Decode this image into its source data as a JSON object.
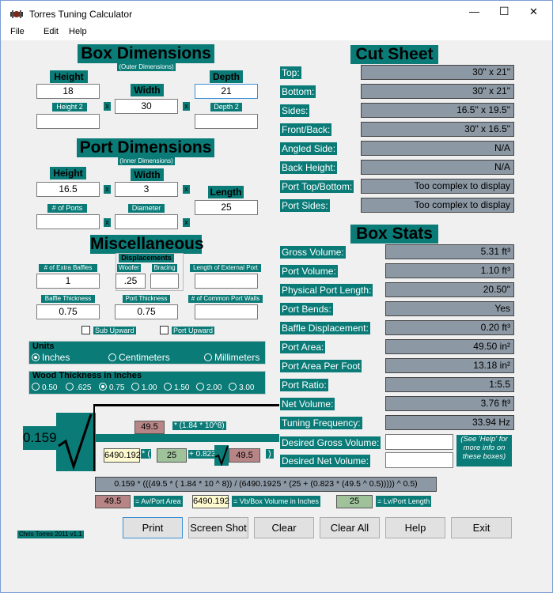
{
  "window": {
    "title": "Torres Tuning Calculator",
    "minimize": "—",
    "maximize": "☐",
    "close": "✕"
  },
  "menu": [
    "File",
    "Edit",
    "Help"
  ],
  "box_dimensions": {
    "title": "Box Dimensions",
    "subtitle": "(Outer Dimensions)",
    "height_label": "Height",
    "height_value": "18",
    "width_label": "Width",
    "width_value": "30",
    "depth_label": "Depth",
    "depth_value": "21",
    "height2_label": "Height 2",
    "height2_value": "",
    "depth2_label": "Depth 2",
    "depth2_value": "",
    "x": "x"
  },
  "port_dimensions": {
    "title": "Port Dimensions",
    "subtitle": "(Inner Dimensions)",
    "height_label": "Height",
    "height_value": "16.5",
    "width_label": "Width",
    "width_value": "3",
    "length_label": "Length",
    "length_value": "25",
    "ports_label": "# of Ports",
    "ports_value": "",
    "diameter_label": "Diameter",
    "diameter_value": ""
  },
  "misc": {
    "title": "Miscellaneous",
    "displacements_label": "Displacements",
    "extra_baffles_label": "# of Extra Baffles",
    "extra_baffles_value": "1",
    "woofer_label": "Woofer",
    "woofer_value": ".25",
    "bracing_label": "Bracing",
    "bracing_value": "",
    "ext_port_label": "Length of External Port",
    "ext_port_value": "",
    "baffle_thickness_label": "Baffle Thickness",
    "baffle_thickness_value": "0.75",
    "port_thickness_label": "Port Thickness",
    "port_thickness_value": "0.75",
    "common_walls_label": "# of Common Port Walls",
    "common_walls_value": "",
    "sub_upward": "Sub Upward",
    "port_upward": "Port Upward"
  },
  "units": {
    "title": "Units",
    "options": [
      "Inches",
      "Centimeters",
      "Millimeters"
    ],
    "selected": "Inches"
  },
  "wood": {
    "title": "Wood Thickness in Inches",
    "options": [
      "0.50",
      ".625",
      "0.75",
      "1.00",
      "1.50",
      "2.00",
      "3.00"
    ],
    "selected": "0.75"
  },
  "cut_sheet": {
    "title": "Cut Sheet",
    "rows": [
      {
        "label": "Top:",
        "value": "30\" x 21\""
      },
      {
        "label": "Bottom:",
        "value": "30\" x 21\""
      },
      {
        "label": "Sides:",
        "value": "16.5\" x 19.5\""
      },
      {
        "label": "Front/Back:",
        "value": "30\" x 16.5\""
      },
      {
        "label": "Angled Side:",
        "value": "N/A"
      },
      {
        "label": "Back Height:",
        "value": "N/A"
      },
      {
        "label": "Port Top/Bottom:",
        "value": "Too complex to display"
      },
      {
        "label": "Port Sides:",
        "value": "Too complex to display"
      }
    ]
  },
  "box_stats": {
    "title": "Box Stats",
    "rows": [
      {
        "label": "Gross Volume:",
        "value": "5.31 ft³"
      },
      {
        "label": "Port Volume:",
        "value": "1.10 ft³"
      },
      {
        "label": "Physical Port Length:",
        "value": "20.50\""
      },
      {
        "label": "Port Bends:",
        "value": "Yes"
      },
      {
        "label": "Baffle Displacement:",
        "value": "0.20 ft³"
      },
      {
        "label": "Port Area:",
        "value": "49.50 in²"
      },
      {
        "label": "Port Area Per Foot",
        "value": "13.18 in²"
      },
      {
        "label": "Port Ratio:",
        "value": "1:5.5"
      },
      {
        "label": "Net Volume:",
        "value": "3.76 ft³"
      },
      {
        "label": "Tuning Frequency:",
        "value": "33.94 Hz"
      }
    ],
    "desired_gross_label": "Desired Gross Volume:",
    "desired_gross_value": "",
    "desired_net_label": "Desired Net Volume:",
    "desired_net_value": "",
    "help_note": "(See 'Help' for more info on these boxes)"
  },
  "formula": {
    "coef": "0.159",
    "av": "49.5",
    "mult": "* (1.84 * 10^8)",
    "vb": "6490.192",
    "open": "* (",
    "lv": "25",
    "plus": "+ 0.823 *",
    "av2": "49.5",
    "close": ")",
    "full": "0.159 * (((49.5 * ( 1.84 * 10 ^ 8)) / (6490.1925 * (25 + (0.823 * (49.5 ^ 0.5))))) ^ 0.5)",
    "legend_av": "49.5",
    "legend_av_label": "= Av/Port Area",
    "legend_vb": "6490.192",
    "legend_vb_label": "= Vb/Box Volume in Inches",
    "legend_lv": "25",
    "legend_lv_label": "= Lv/Port Length"
  },
  "buttons": {
    "print": "Print",
    "screenshot": "Screen Shot",
    "clear": "Clear",
    "clear_all": "Clear All",
    "help": "Help",
    "exit": "Exit"
  },
  "footer": "Chris Torres 2011 v1.1"
}
